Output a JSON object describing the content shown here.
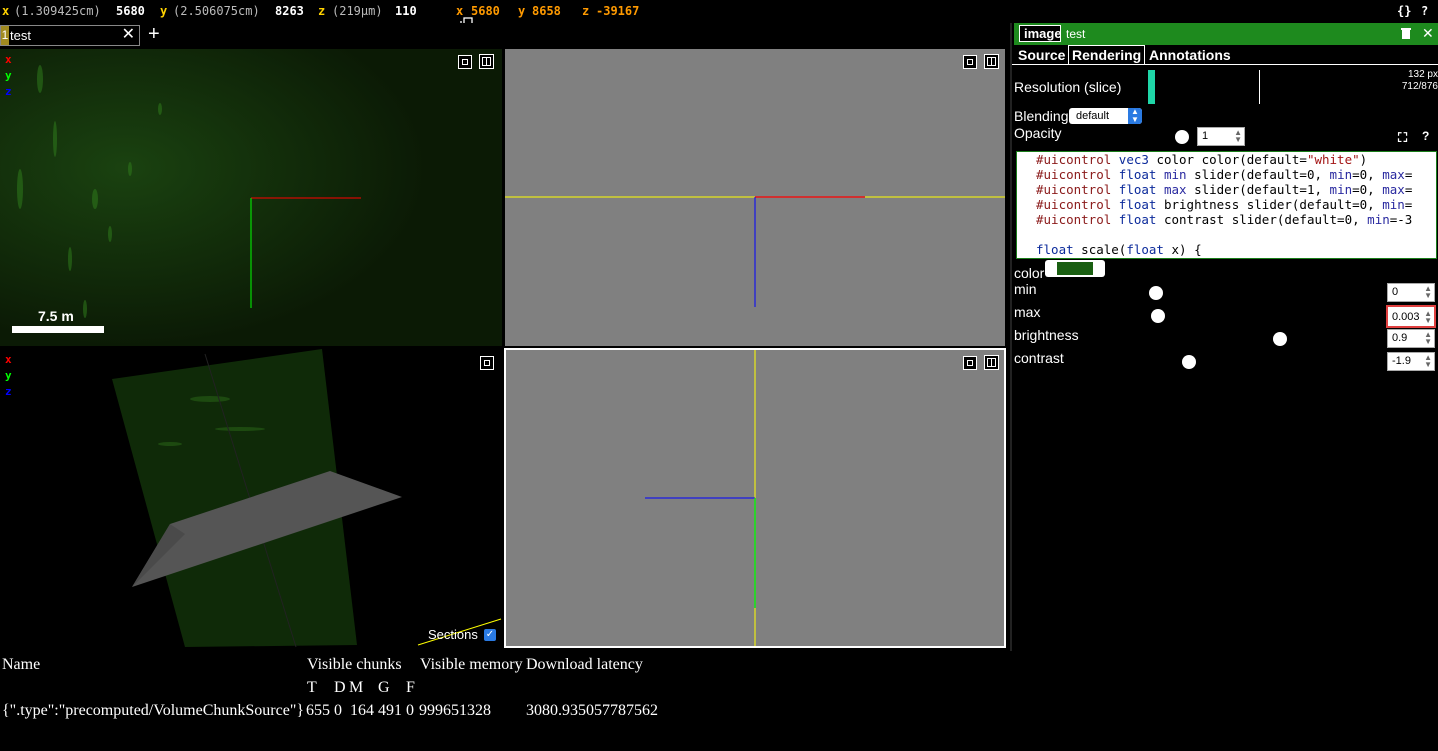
{
  "coords": {
    "x_label": "x",
    "x_scale": "(1.309425cm)",
    "x_value": "5680",
    "y_label": "y",
    "y_scale": "(2.506075cm)",
    "y_value": "8263",
    "z_label": "z",
    "z_scale": "(219µm)",
    "z_value": "110",
    "mouse_x_label": "x",
    "mouse_x": "5680",
    "mouse_y_label": "y",
    "mouse_y": "8658",
    "mouse_z_label": "z",
    "mouse_z": "-39167",
    "json_button": "{}",
    "help_button": "?"
  },
  "layer_tab": {
    "number": "1",
    "name": "test",
    "close": "✕",
    "add": "+"
  },
  "views": {
    "axis_x": "x",
    "axis_y": "y",
    "axis_z": "z",
    "scale_bar_label": "7.5 m",
    "sections_label": "Sections",
    "sections_checked": true
  },
  "side_panel": {
    "layer_type": "image",
    "layer_name": "test",
    "tabs": [
      "Source",
      "Rendering",
      "Annotations"
    ],
    "active_tab": "Rendering",
    "resolution_label": "Resolution (slice)",
    "resolution_px": "132 px",
    "resolution_chunks": "712/876",
    "blending_label": "Blending",
    "blending_value": "default",
    "opacity_label": "Opacity",
    "opacity_value": "1",
    "shader_lines": [
      "#uicontrol vec3 color color(default=\"white\")",
      "#uicontrol float min slider(default=0, min=0, max=",
      "#uicontrol float max slider(default=1, min=0, max=",
      "#uicontrol float brightness slider(default=0, min=",
      "#uicontrol float contrast slider(default=0, min=-3",
      "",
      "float scale(float x) {"
    ],
    "controls": {
      "color_label": "color",
      "color_value": "#1a5f12",
      "min_label": "min",
      "min_value": "0",
      "max_label": "max",
      "max_value": "0.003",
      "brightness_label": "brightness",
      "brightness_value": "0.9",
      "contrast_label": "contrast",
      "contrast_value": "-1.9"
    },
    "fullscreen_icon": "⛶",
    "help": "?"
  },
  "stats": {
    "headers": [
      "Name",
      "Visible chunks",
      "Visible memory",
      "Download latency"
    ],
    "subheaders": [
      "T",
      "D",
      "M",
      "G",
      "F"
    ],
    "row_name": "{\".type\":\"precomputed/VolumeChunkSource\"}",
    "row_counts": "655 0  164 491 0",
    "row_memory": "999651328",
    "row_latency": "3080.935057787562"
  },
  "colors": {
    "accent_green": "#1e8a1e",
    "axis_red": "#ff0000",
    "axis_green": "#00ff00",
    "axis_blue": "#0000ff",
    "axis_yellow": "#ffff00",
    "panel_gray": "#808080"
  }
}
